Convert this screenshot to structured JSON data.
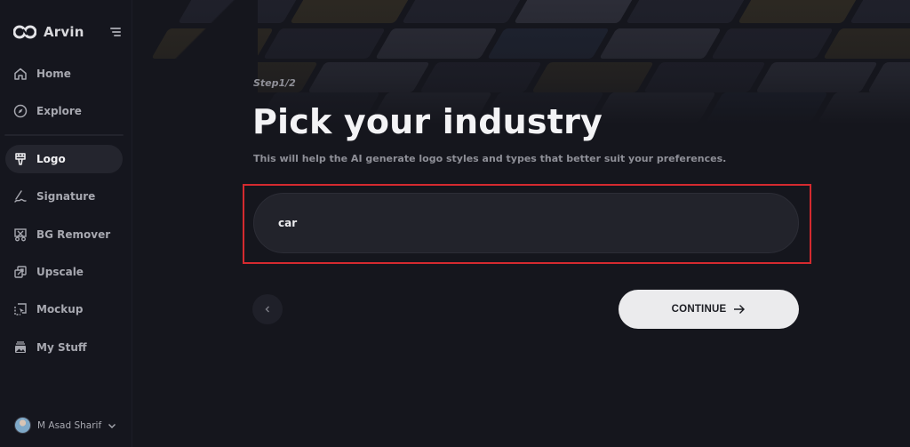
{
  "brand": {
    "name": "Arvin",
    "logo_icon": "infinity-logo-icon"
  },
  "sidebar": {
    "menu_icon": "menu-toggle-icon",
    "items": [
      {
        "label": "Home",
        "icon": "home-icon",
        "active": false
      },
      {
        "label": "Explore",
        "icon": "compass-icon",
        "active": false
      },
      {
        "label": "Logo",
        "icon": "brush-icon",
        "active": true
      },
      {
        "label": "Signature",
        "icon": "signature-icon",
        "active": false
      },
      {
        "label": "BG Remover",
        "icon": "bg-remover-icon",
        "active": false
      },
      {
        "label": "Upscale",
        "icon": "upscale-icon",
        "active": false
      },
      {
        "label": "Mockup",
        "icon": "mockup-icon",
        "active": false
      },
      {
        "label": "My Stuff",
        "icon": "gallery-icon",
        "active": false
      }
    ],
    "user": {
      "name": "M Asad Sharif"
    }
  },
  "main": {
    "step": "Step1/2",
    "title": "Pick your industry",
    "subtitle": "This will help the AI generate logo styles and types that better suit your preferences.",
    "industry_input": {
      "value": "car"
    },
    "continue_label": "CONTINUE"
  },
  "colors": {
    "background": "#15161d",
    "highlight_border": "#d42a2f",
    "continue_bg": "#ebebed",
    "input_bg": "#22232b"
  }
}
